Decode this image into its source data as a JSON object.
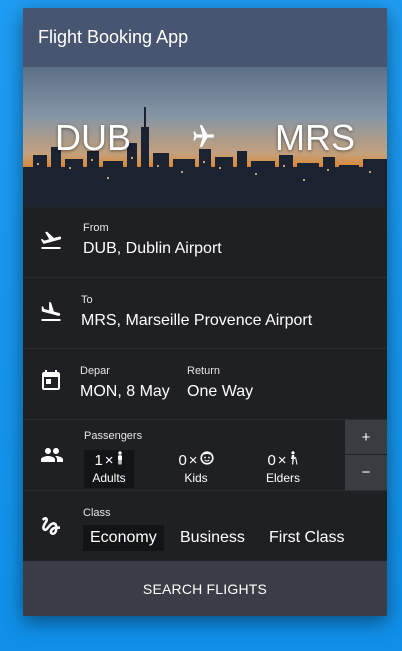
{
  "app": {
    "title": "Flight Booking App"
  },
  "hero": {
    "from_code": "DUB",
    "to_code": "MRS",
    "plane_icon": "airplane-icon"
  },
  "from": {
    "label": "From",
    "value": "DUB, Dublin Airport",
    "icon": "flight-takeoff-icon"
  },
  "to": {
    "label": "To",
    "value": "MRS, Marseille Provence Airport",
    "icon": "flight-land-icon"
  },
  "dates": {
    "icon": "calendar-icon",
    "depart_label": "Depar",
    "depart_value": "MON, 8 May",
    "return_label": "Return",
    "return_value": "One Way"
  },
  "passengers": {
    "icon": "people-icon",
    "label": "Passengers",
    "adults": {
      "count": "1",
      "times": "×",
      "label": "Adults"
    },
    "kids": {
      "count": "0",
      "times": "×",
      "label": "Kids"
    },
    "elders": {
      "count": "0",
      "times": "×",
      "label": "Elders"
    },
    "plus": "+",
    "minus": "−"
  },
  "class": {
    "icon": "seat-icon",
    "label": "Class",
    "options": [
      "Economy",
      "Business",
      "First Class"
    ],
    "selected": "Economy"
  },
  "search": {
    "label": "SEARCH FLIGHTS"
  },
  "colors": {
    "background": "#1e9cf2",
    "appbar": "#485570",
    "card": "#1f2023",
    "search_button": "#3a3d45"
  }
}
